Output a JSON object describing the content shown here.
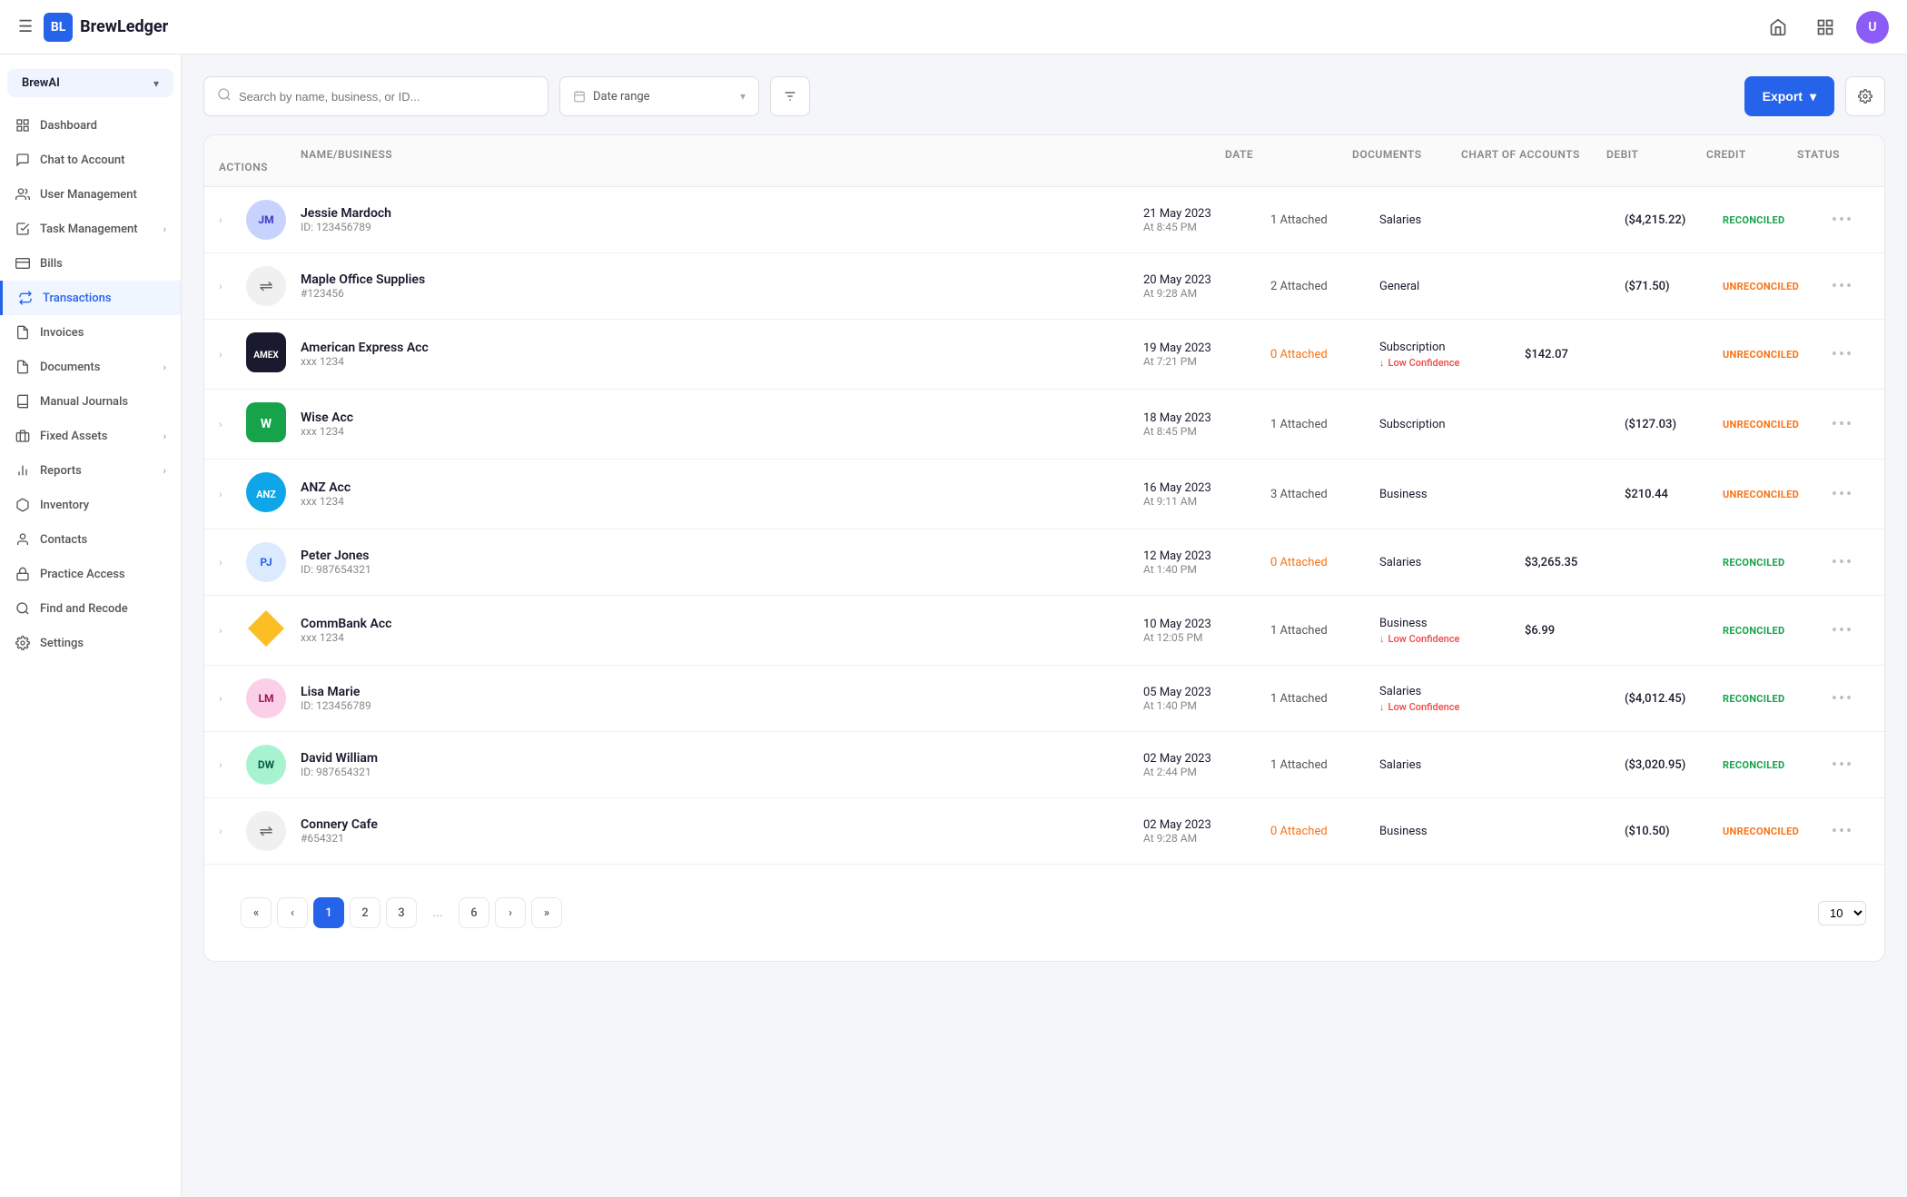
{
  "app": {
    "name": "BrewLedger",
    "logo_text": "BL",
    "menu_icon": "☰"
  },
  "topbar": {
    "home_icon": "⌂",
    "grid_icon": "⋮⋮⋮",
    "export_label": "Export",
    "export_arrow": "▾"
  },
  "org_selector": {
    "name": "BrewAI",
    "chevron": "▾"
  },
  "sidebar": {
    "items": [
      {
        "id": "dashboard",
        "label": "Dashboard",
        "icon": "dashboard"
      },
      {
        "id": "chat",
        "label": "Chat to Account",
        "icon": "chat"
      },
      {
        "id": "user-management",
        "label": "User Management",
        "icon": "users"
      },
      {
        "id": "task-management",
        "label": "Task Management",
        "icon": "tasks",
        "has_arrow": true
      },
      {
        "id": "bills",
        "label": "Bills",
        "icon": "bills"
      },
      {
        "id": "transactions",
        "label": "Transactions",
        "icon": "transactions",
        "active": true
      },
      {
        "id": "invoices",
        "label": "Invoices",
        "icon": "invoices"
      },
      {
        "id": "documents",
        "label": "Documents",
        "icon": "documents",
        "has_arrow": true
      },
      {
        "id": "manual-journals",
        "label": "Manual Journals",
        "icon": "journals"
      },
      {
        "id": "fixed-assets",
        "label": "Fixed Assets",
        "icon": "assets",
        "has_arrow": true
      },
      {
        "id": "reports",
        "label": "Reports",
        "icon": "reports",
        "has_arrow": true
      },
      {
        "id": "inventory",
        "label": "Inventory",
        "icon": "inventory"
      },
      {
        "id": "contacts",
        "label": "Contacts",
        "icon": "contacts"
      },
      {
        "id": "practice-access",
        "label": "Practice Access",
        "icon": "practice"
      },
      {
        "id": "find-recode",
        "label": "Find and Recode",
        "icon": "recode"
      },
      {
        "id": "settings",
        "label": "Settings",
        "icon": "settings"
      }
    ]
  },
  "toolbar": {
    "search_placeholder": "Search by name, business, or ID...",
    "date_range_placeholder": "Date range",
    "filter_icon": "filter",
    "export_label": "Export",
    "settings_icon": "settings"
  },
  "table": {
    "columns": [
      "",
      "",
      "Name/Business",
      "Date",
      "Documents",
      "Chart of Accounts",
      "Debit",
      "Credit",
      "Status",
      "Actions"
    ],
    "rows": [
      {
        "id": 1,
        "avatar_type": "photo",
        "avatar_color": "#e0e7ff",
        "avatar_initials": "JM",
        "name": "Jessie Mardoch",
        "id_label": "ID: 123456789",
        "date": "21 May 2023",
        "time": "At 8:45 PM",
        "documents": "1 Attached",
        "docs_type": "normal",
        "chart_of_accounts": "Salaries",
        "low_confidence": false,
        "debit": "",
        "credit": "($4,215.22)",
        "status": "RECONCILED",
        "status_type": "reconciled"
      },
      {
        "id": 2,
        "avatar_type": "transfer",
        "avatar_color": "#f0f0f0",
        "avatar_initials": "⇌",
        "name": "Maple Office Supplies",
        "id_label": "#123456",
        "date": "20 May 2023",
        "time": "At 9:28 AM",
        "documents": "2 Attached",
        "docs_type": "normal",
        "chart_of_accounts": "General",
        "low_confidence": false,
        "debit": "",
        "credit": "($71.50)",
        "status": "UNRECONCILED",
        "status_type": "unreconciled"
      },
      {
        "id": 3,
        "avatar_type": "logo",
        "avatar_color": "#1a1a2e",
        "avatar_initials": "AE",
        "name": "American Express Acc",
        "id_label": "xxx 1234",
        "date": "19 May 2023",
        "time": "At 7:21 PM",
        "documents": "0 Attached",
        "docs_type": "orange",
        "chart_of_accounts": "Subscription",
        "low_confidence": true,
        "debit": "$142.07",
        "credit": "",
        "status": "UNRECONCILED",
        "status_type": "unreconciled"
      },
      {
        "id": 4,
        "avatar_type": "logo",
        "avatar_color": "#16a34a",
        "avatar_initials": "W",
        "name": "Wise Acc",
        "id_label": "xxx 1234",
        "date": "18 May 2023",
        "time": "At 8:45 PM",
        "documents": "1 Attached",
        "docs_type": "normal",
        "chart_of_accounts": "Subscription",
        "low_confidence": false,
        "debit": "",
        "credit": "($127.03)",
        "status": "UNRECONCILED",
        "status_type": "unreconciled"
      },
      {
        "id": 5,
        "avatar_type": "logo",
        "avatar_color": "#0ea5e9",
        "avatar_initials": "ANZ",
        "name": "ANZ Acc",
        "id_label": "xxx 1234",
        "date": "16 May 2023",
        "time": "At 9:11 AM",
        "documents": "3 Attached",
        "docs_type": "normal",
        "chart_of_accounts": "Business",
        "low_confidence": false,
        "debit": "",
        "credit": "$210.44",
        "status": "UNRECONCILED",
        "status_type": "unreconciled"
      },
      {
        "id": 6,
        "avatar_type": "photo",
        "avatar_color": "#dbeafe",
        "avatar_initials": "PJ",
        "name": "Peter Jones",
        "id_label": "ID: 987654321",
        "date": "12 May 2023",
        "time": "At 1:40 PM",
        "documents": "0 Attached",
        "docs_type": "orange",
        "chart_of_accounts": "Salaries",
        "low_confidence": false,
        "debit": "$3,265.35",
        "credit": "",
        "status": "RECONCILED",
        "status_type": "reconciled"
      },
      {
        "id": 7,
        "avatar_type": "logo",
        "avatar_color": "#fbbf24",
        "avatar_initials": "CB",
        "name": "CommBank Acc",
        "id_label": "xxx 1234",
        "date": "10 May 2023",
        "time": "At 12:05 PM",
        "documents": "1 Attached",
        "docs_type": "normal",
        "chart_of_accounts": "Business",
        "low_confidence": true,
        "debit": "$6.99",
        "credit": "",
        "status": "RECONCILED",
        "status_type": "reconciled"
      },
      {
        "id": 8,
        "avatar_type": "photo",
        "avatar_color": "#fce7f3",
        "avatar_initials": "LM",
        "name": "Lisa Marie",
        "id_label": "ID: 123456789",
        "date": "05 May 2023",
        "time": "At 1:40 PM",
        "documents": "1 Attached",
        "docs_type": "normal",
        "chart_of_accounts": "Salaries",
        "low_confidence": true,
        "debit": "",
        "credit": "($4,012.45)",
        "status": "RECONCILED",
        "status_type": "reconciled"
      },
      {
        "id": 9,
        "avatar_type": "photo",
        "avatar_color": "#d1fae5",
        "avatar_initials": "DW",
        "name": "David William",
        "id_label": "ID: 987654321",
        "date": "02 May 2023",
        "time": "At 2:44 PM",
        "documents": "1 Attached",
        "docs_type": "normal",
        "chart_of_accounts": "Salaries",
        "low_confidence": false,
        "debit": "",
        "credit": "($3,020.95)",
        "status": "RECONCILED",
        "status_type": "reconciled"
      },
      {
        "id": 10,
        "avatar_type": "transfer",
        "avatar_color": "#f0f0f0",
        "avatar_initials": "⇌",
        "name": "Connery Cafe",
        "id_label": "#654321",
        "date": "02 May 2023",
        "time": "At 9:28 AM",
        "documents": "0 Attached",
        "docs_type": "orange",
        "chart_of_accounts": "Business",
        "low_confidence": false,
        "debit": "",
        "credit": "($10.50)",
        "status": "UNRECONCILED",
        "status_type": "unreconciled"
      }
    ]
  },
  "pagination": {
    "pages": [
      "1",
      "2",
      "3",
      "...",
      "6"
    ],
    "current": "1",
    "per_page": "10",
    "first_icon": "«",
    "prev_icon": "‹",
    "next_icon": "›",
    "last_icon": "»"
  },
  "low_confidence_label": "Low Confidence"
}
